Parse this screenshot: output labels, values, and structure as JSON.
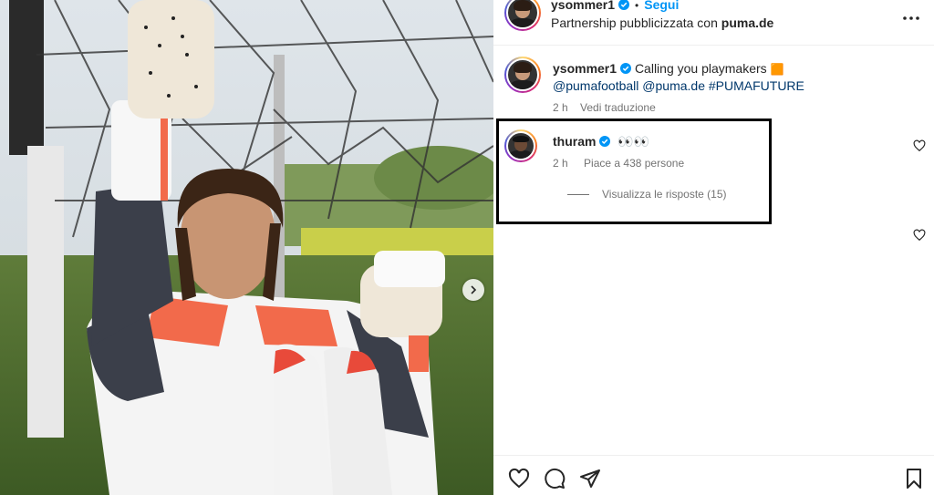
{
  "post": {
    "author": "ysommer1",
    "follow_label": "Segui",
    "separator": "•",
    "partnership_prefix": "Partnership pubblicizzata con",
    "partner": "puma.de"
  },
  "caption": {
    "author": "ysommer1",
    "text": "Calling you playmakers",
    "emoji": "🟧",
    "mentions": [
      "@pumafootball",
      "@puma.de",
      "#PUMAFUTURE"
    ],
    "time": "2 h",
    "translate_label": "Vedi traduzione"
  },
  "comment": {
    "author": "thuram",
    "text": "👀👀",
    "time": "2 h",
    "likes_label": "Piace a 438 persone",
    "replies_label": "Visualizza le risposte (15)"
  },
  "colors": {
    "accent": "#0095f6",
    "link": "#00376b",
    "muted": "#737373",
    "verified": "#0095f6"
  },
  "icons": {
    "more": "more-horizontal-icon",
    "like": "heart-icon",
    "comment": "comment-icon",
    "share": "paper-plane-icon",
    "save": "bookmark-icon",
    "next": "chevron-right-icon"
  }
}
